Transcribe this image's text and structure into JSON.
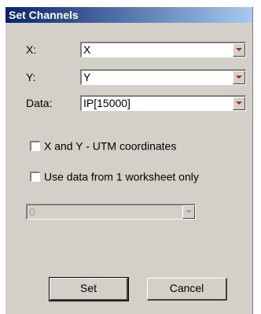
{
  "window": {
    "title": "Set Channels"
  },
  "fields": [
    {
      "label": "X:",
      "value": "X"
    },
    {
      "label": "Y:",
      "value": "Y"
    },
    {
      "label": "Data:",
      "value": "IP[15000]"
    }
  ],
  "checkboxes": [
    {
      "label": "X and Y - UTM coordinates",
      "checked": false
    },
    {
      "label": "Use data from 1 worksheet only",
      "checked": false
    }
  ],
  "worksheet_select": {
    "value": "0",
    "enabled": false
  },
  "buttons": {
    "set": "Set",
    "cancel": "Cancel"
  },
  "colors": {
    "dropdown_arrow": "#b0262e",
    "title_start": "#0a246a",
    "dialog_bg": "#d4d0c8"
  }
}
